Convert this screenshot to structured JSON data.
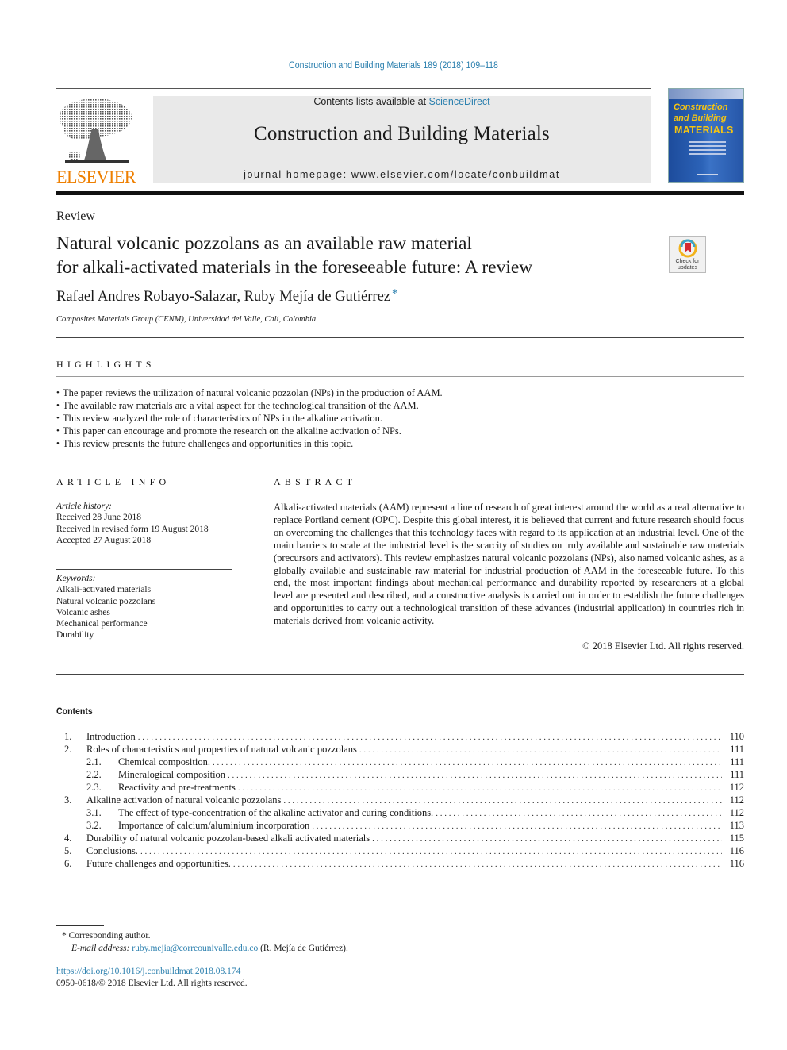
{
  "header": {
    "journal_reference": "Construction and Building Materials 189 (2018) 109–118",
    "contents_prefix": "Contents lists available at ",
    "contents_link": "ScienceDirect",
    "journal_title": "Construction and Building Materials",
    "homepage": "journal homepage: www.elsevier.com/locate/conbuildmat",
    "publisher_logo_text": "ELSEVIER",
    "cover": {
      "line1": "Construction",
      "line2": "and Building",
      "line3": "MATERIALS"
    },
    "colors": {
      "link": "#2a7fae",
      "elsevier_orange": "#ee7f00",
      "cover_blue": "#2c63b8",
      "cover_yellow": "#f6c511"
    }
  },
  "article": {
    "type": "Review",
    "title_line1": "Natural volcanic pozzolans as an available raw material",
    "title_line2": "for alkali-activated materials in the foreseeable future: A review",
    "check_updates": "Check for updates",
    "check_updates_line1": "Check for",
    "check_updates_line2": "updates",
    "authors": "Rafael Andres Robayo-Salazar, Ruby Mejía de Gutiérrez",
    "corresponding_marker": "*",
    "affiliation": "Composites Materials Group (CENM), Universidad del Valle, Cali, Colombia"
  },
  "highlights": {
    "heading": "HIGHLIGHTS",
    "items": [
      "The paper reviews the utilization of natural volcanic pozzolan (NPs) in the production of AAM.",
      "The available raw materials are a vital aspect for the technological transition of the AAM.",
      "This review analyzed the role of characteristics of NPs in the alkaline activation.",
      "This paper can encourage and promote the research on the alkaline activation of NPs.",
      "This review presents the future challenges and opportunities in this topic."
    ]
  },
  "article_info": {
    "heading": "ARTICLE INFO",
    "history_label": "Article history:",
    "history": [
      "Received 28 June 2018",
      "Received in revised form 19 August 2018",
      "Accepted 27 August 2018"
    ],
    "keywords_label": "Keywords:",
    "keywords": [
      "Alkali-activated materials",
      "Natural volcanic pozzolans",
      "Volcanic ashes",
      "Mechanical performance",
      "Durability"
    ]
  },
  "abstract": {
    "heading": "ABSTRACT",
    "text": "Alkali-activated materials (AAM) represent a line of research of great interest around the world as a real alternative to replace Portland cement (OPC). Despite this global interest, it is believed that current and future research should focus on overcoming the challenges that this technology faces with regard to its application at an industrial level. One of the main barriers to scale at the industrial level is the scarcity of studies on truly available and sustainable raw materials (precursors and activators). This review emphasizes natural volcanic pozzolans (NPs), also named volcanic ashes, as a globally available and sustainable raw material for industrial production of AAM in the foreseeable future. To this end, the most important findings about mechanical performance and durability reported by researchers at a global level are presented and described, and a constructive analysis is carried out in order to establish the future challenges and opportunities to carry out a technological transition of these advances (industrial application) in countries rich in materials derived from volcanic activity.",
    "copyright": "© 2018 Elsevier Ltd. All rights reserved."
  },
  "contents": {
    "heading": "Contents",
    "entries": [
      {
        "num": "1.",
        "title": "Introduction",
        "page": "110",
        "level": 1
      },
      {
        "num": "2.",
        "title": "Roles of characteristics and properties of natural volcanic pozzolans",
        "page": "111",
        "level": 1
      },
      {
        "num": "2.1.",
        "title": "Chemical composition.",
        "page": "111",
        "level": 2
      },
      {
        "num": "2.2.",
        "title": "Mineralogical composition",
        "page": "111",
        "level": 2
      },
      {
        "num": "2.3.",
        "title": "Reactivity and pre-treatments",
        "page": "112",
        "level": 2
      },
      {
        "num": "3.",
        "title": "Alkaline activation of natural volcanic pozzolans",
        "page": "112",
        "level": 1
      },
      {
        "num": "3.1.",
        "title": "The effect of type-concentration of the alkaline activator and curing conditions.",
        "page": "112",
        "level": 2
      },
      {
        "num": "3.2.",
        "title": "Importance of calcium/aluminium incorporation",
        "page": "113",
        "level": 2
      },
      {
        "num": "4.",
        "title": "Durability of natural volcanic pozzolan-based alkali activated materials",
        "page": "115",
        "level": 1
      },
      {
        "num": "5.",
        "title": "Conclusions.",
        "page": "116",
        "level": 1
      },
      {
        "num": "6.",
        "title": "Future challenges and opportunities.",
        "page": "116",
        "level": 1
      }
    ]
  },
  "footnote": {
    "marker": "*",
    "corresponding": "Corresponding author.",
    "email_label": "E-mail address:",
    "email": "ruby.mejia@correounivalle.edu.co",
    "email_owner": "(R. Mejía de Gutiérrez)."
  },
  "footer": {
    "doi": "https://doi.org/10.1016/j.conbuildmat.2018.08.174",
    "issn_copyright": "0950-0618/© 2018 Elsevier Ltd. All rights reserved."
  }
}
